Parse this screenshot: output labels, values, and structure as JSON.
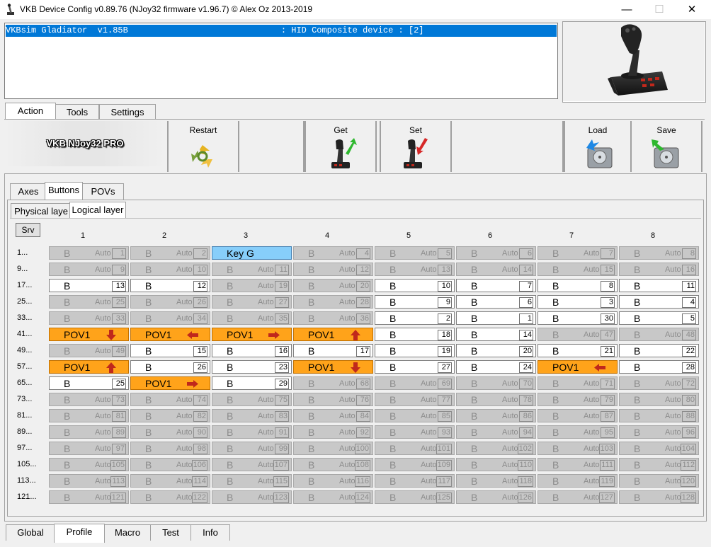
{
  "window": {
    "title": "VKB Device Config v0.89.76 (NJoy32 firmware v1.96.7) © Alex Oz 2013-2019",
    "minimize": "—",
    "maximize": "☐",
    "close": "✕"
  },
  "device_list": {
    "selected_row": "VKBsim Gladiator  v1.85B                              : HID Composite device : [2]"
  },
  "top_tabs": [
    "Action",
    "Tools",
    "Settings"
  ],
  "action_panel": {
    "device_name": "VKB NJoy32 PRO",
    "restart_label": "Restart",
    "get_label": "Get",
    "set_label": "Set",
    "load_label": "Load",
    "save_label": "Save"
  },
  "sub_tabs": [
    "Axes",
    "Buttons",
    "POVs"
  ],
  "layer_tabs": [
    "Physical laye",
    "Logical layer"
  ],
  "srv_label": "Srv",
  "column_headers": [
    "1",
    "2",
    "3",
    "4",
    "5",
    "6",
    "7",
    "8"
  ],
  "row_headers": [
    "1...",
    "9...",
    "17...",
    "25...",
    "33...",
    "41...",
    "49...",
    "57...",
    "65...",
    "73...",
    "81...",
    "89...",
    "97...",
    "105...",
    "113...",
    "121..."
  ],
  "auto_label": "Auto",
  "grid": [
    [
      [
        "dis",
        "B",
        "1"
      ],
      [
        "dis",
        "B",
        "2"
      ],
      [
        "key",
        "Key G",
        ""
      ],
      [
        "dis",
        "B",
        "4"
      ],
      [
        "dis",
        "B",
        "5"
      ],
      [
        "dis",
        "B",
        "6"
      ],
      [
        "dis",
        "B",
        "7"
      ],
      [
        "dis",
        "B",
        "8"
      ]
    ],
    [
      [
        "dis",
        "B",
        "9"
      ],
      [
        "dis",
        "B",
        "10"
      ],
      [
        "dis",
        "B",
        "11"
      ],
      [
        "dis",
        "B",
        "12"
      ],
      [
        "dis",
        "B",
        "13"
      ],
      [
        "dis",
        "B",
        "14"
      ],
      [
        "dis",
        "B",
        "15"
      ],
      [
        "dis",
        "B",
        "16"
      ]
    ],
    [
      [
        "act",
        "B",
        "13"
      ],
      [
        "act",
        "B",
        "12"
      ],
      [
        "dis",
        "B",
        "19"
      ],
      [
        "dis",
        "B",
        "20"
      ],
      [
        "act",
        "B",
        "10"
      ],
      [
        "act",
        "B",
        "7"
      ],
      [
        "act",
        "B",
        "8"
      ],
      [
        "act",
        "B",
        "11"
      ]
    ],
    [
      [
        "dis",
        "B",
        "25"
      ],
      [
        "dis",
        "B",
        "26"
      ],
      [
        "dis",
        "B",
        "27"
      ],
      [
        "dis",
        "B",
        "28"
      ],
      [
        "act",
        "B",
        "9"
      ],
      [
        "act",
        "B",
        "6"
      ],
      [
        "act",
        "B",
        "3"
      ],
      [
        "act",
        "B",
        "4"
      ]
    ],
    [
      [
        "dis",
        "B",
        "33"
      ],
      [
        "dis",
        "B",
        "34"
      ],
      [
        "dis",
        "B",
        "35"
      ],
      [
        "dis",
        "B",
        "36"
      ],
      [
        "act",
        "B",
        "2"
      ],
      [
        "act",
        "B",
        "1"
      ],
      [
        "act",
        "B",
        "30"
      ],
      [
        "act",
        "B",
        "5"
      ]
    ],
    [
      [
        "pov",
        "POV1",
        "down"
      ],
      [
        "pov",
        "POV1",
        "left"
      ],
      [
        "pov",
        "POV1",
        "right"
      ],
      [
        "pov",
        "POV1",
        "up"
      ],
      [
        "act",
        "B",
        "18"
      ],
      [
        "act",
        "B",
        "14"
      ],
      [
        "dis",
        "B",
        "47"
      ],
      [
        "dis",
        "B",
        "48"
      ]
    ],
    [
      [
        "dis",
        "B",
        "49"
      ],
      [
        "act",
        "B",
        "15"
      ],
      [
        "act",
        "B",
        "16"
      ],
      [
        "act",
        "B",
        "17"
      ],
      [
        "act",
        "B",
        "19"
      ],
      [
        "act",
        "B",
        "20"
      ],
      [
        "act",
        "B",
        "21"
      ],
      [
        "act",
        "B",
        "22"
      ]
    ],
    [
      [
        "pov",
        "POV1",
        "up"
      ],
      [
        "act",
        "B",
        "26"
      ],
      [
        "act",
        "B",
        "23"
      ],
      [
        "pov",
        "POV1",
        "down"
      ],
      [
        "act",
        "B",
        "27"
      ],
      [
        "act",
        "B",
        "24"
      ],
      [
        "pov",
        "POV1",
        "left"
      ],
      [
        "act",
        "B",
        "28"
      ]
    ],
    [
      [
        "act",
        "B",
        "25"
      ],
      [
        "pov",
        "POV1",
        "right"
      ],
      [
        "act",
        "B",
        "29"
      ],
      [
        "dis",
        "B",
        "68"
      ],
      [
        "dis",
        "B",
        "69"
      ],
      [
        "dis",
        "B",
        "70"
      ],
      [
        "dis",
        "B",
        "71"
      ],
      [
        "dis",
        "B",
        "72"
      ]
    ],
    [
      [
        "dis",
        "B",
        "73"
      ],
      [
        "dis",
        "B",
        "74"
      ],
      [
        "dis",
        "B",
        "75"
      ],
      [
        "dis",
        "B",
        "76"
      ],
      [
        "dis",
        "B",
        "77"
      ],
      [
        "dis",
        "B",
        "78"
      ],
      [
        "dis",
        "B",
        "79"
      ],
      [
        "dis",
        "B",
        "80"
      ]
    ],
    [
      [
        "dis",
        "B",
        "81"
      ],
      [
        "dis",
        "B",
        "82"
      ],
      [
        "dis",
        "B",
        "83"
      ],
      [
        "dis",
        "B",
        "84"
      ],
      [
        "dis",
        "B",
        "85"
      ],
      [
        "dis",
        "B",
        "86"
      ],
      [
        "dis",
        "B",
        "87"
      ],
      [
        "dis",
        "B",
        "88"
      ]
    ],
    [
      [
        "dis",
        "B",
        "89"
      ],
      [
        "dis",
        "B",
        "90"
      ],
      [
        "dis",
        "B",
        "91"
      ],
      [
        "dis",
        "B",
        "92"
      ],
      [
        "dis",
        "B",
        "93"
      ],
      [
        "dis",
        "B",
        "94"
      ],
      [
        "dis",
        "B",
        "95"
      ],
      [
        "dis",
        "B",
        "96"
      ]
    ],
    [
      [
        "dis",
        "B",
        "97"
      ],
      [
        "dis",
        "B",
        "98"
      ],
      [
        "dis",
        "B",
        "99"
      ],
      [
        "dis",
        "B",
        "100"
      ],
      [
        "dis",
        "B",
        "101"
      ],
      [
        "dis",
        "B",
        "102"
      ],
      [
        "dis",
        "B",
        "103"
      ],
      [
        "dis",
        "B",
        "104"
      ]
    ],
    [
      [
        "dis",
        "B",
        "105"
      ],
      [
        "dis",
        "B",
        "106"
      ],
      [
        "dis",
        "B",
        "107"
      ],
      [
        "dis",
        "B",
        "108"
      ],
      [
        "dis",
        "B",
        "109"
      ],
      [
        "dis",
        "B",
        "110"
      ],
      [
        "dis",
        "B",
        "111"
      ],
      [
        "dis",
        "B",
        "112"
      ]
    ],
    [
      [
        "dis",
        "B",
        "113"
      ],
      [
        "dis",
        "B",
        "114"
      ],
      [
        "dis",
        "B",
        "115"
      ],
      [
        "dis",
        "B",
        "116"
      ],
      [
        "dis",
        "B",
        "117"
      ],
      [
        "dis",
        "B",
        "118"
      ],
      [
        "dis",
        "B",
        "119"
      ],
      [
        "dis",
        "B",
        "120"
      ]
    ],
    [
      [
        "dis",
        "B",
        "121"
      ],
      [
        "dis",
        "B",
        "122"
      ],
      [
        "dis",
        "B",
        "123"
      ],
      [
        "dis",
        "B",
        "124"
      ],
      [
        "dis",
        "B",
        "125"
      ],
      [
        "dis",
        "B",
        "126"
      ],
      [
        "dis",
        "B",
        "127"
      ],
      [
        "dis",
        "B",
        "128"
      ]
    ]
  ],
  "bottom_tabs": [
    "Global",
    "Profile",
    "Macro",
    "Test",
    "Info"
  ],
  "icons": {
    "app": "joystick-icon",
    "restart": "recycle-icon",
    "get": "joystick-get-icon",
    "set": "joystick-set-icon",
    "load": "disk-load-icon",
    "save": "disk-save-icon",
    "device": "joystick-photo"
  },
  "colors": {
    "selection": "#0078d7",
    "pov": "#ffa31a",
    "key": "#87cefa",
    "arrow": "#c0281c"
  }
}
